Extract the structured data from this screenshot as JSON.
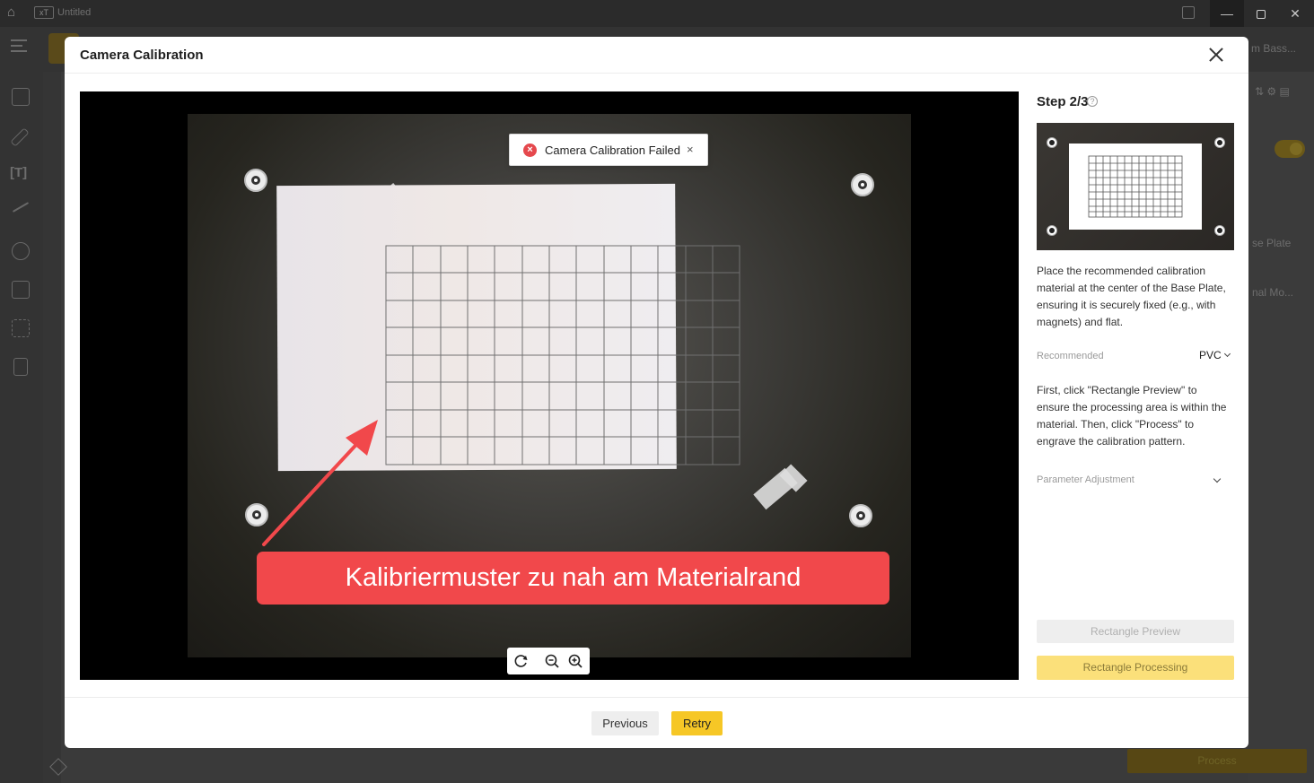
{
  "app": {
    "title": "Untitled",
    "logo_text": "xTool",
    "header_right_text": "m Bass...",
    "panel_labels": [
      "se Plate",
      "nal Mo..."
    ],
    "process_label": "Process"
  },
  "modal": {
    "title": "Camera Calibration",
    "toast": {
      "message": "Camera Calibration Failed",
      "close_glyph": "×"
    },
    "annotation": "Kalibriermuster zu nah am Materialrand",
    "step": {
      "label": "Step 2/3",
      "help_glyph": "?"
    },
    "instructions": "Place the recommended calibration material at the center of the Base Plate, ensuring it is securely fixed (e.g., with magnets) and flat.",
    "recommended": {
      "label": "Recommended",
      "value": "PVC"
    },
    "process_hint": "First, click \"Rectangle Preview\" to ensure the processing area is within the material. Then, click \"Process\" to engrave the calibration pattern.",
    "parameter_adjustment": "Parameter Adjustment",
    "buttons": {
      "rectangle_preview": "Rectangle Preview",
      "rectangle_processing": "Rectangle Processing",
      "previous": "Previous",
      "retry": "Retry"
    }
  },
  "colors": {
    "accent_yellow": "#f6c726",
    "annotation_red": "#f1484b",
    "error_red": "#e5484d"
  }
}
